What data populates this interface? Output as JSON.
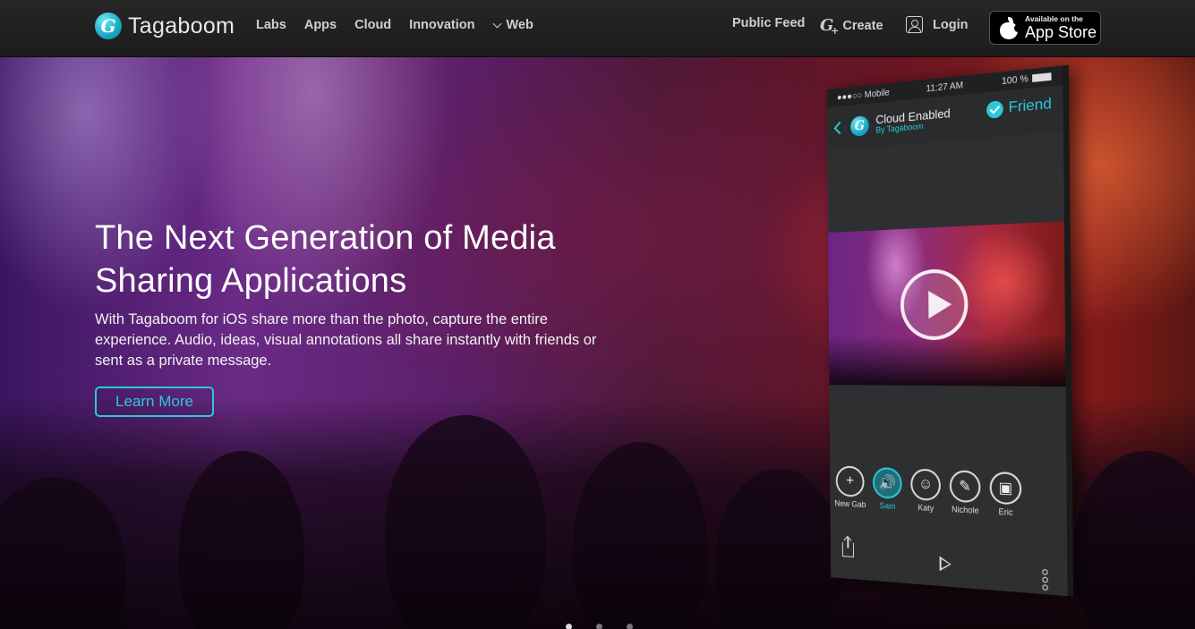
{
  "brand": {
    "name": "Tagaboom",
    "logo_letter": "G"
  },
  "nav": {
    "items": [
      {
        "label": "Labs"
      },
      {
        "label": "Apps"
      },
      {
        "label": "Cloud"
      },
      {
        "label": "Innovation"
      },
      {
        "label": "Web"
      }
    ],
    "public_feed": "Public Feed",
    "create": "Create",
    "login": "Login",
    "app_store": {
      "small": "Available on the",
      "big": "App Store"
    }
  },
  "hero": {
    "title": "The Next Generation of Media Sharing Applications",
    "text": "With Tagaboom for iOS share more than the photo, capture the entire experience. Audio, ideas, visual annotations all share instantly with friends or sent as a private message.",
    "cta": "Learn More"
  },
  "phone": {
    "carrier": "Mobile",
    "time": "11:27 AM",
    "battery": "100 %",
    "title": "Cloud Enabled",
    "subtitle": "By Tagaboom",
    "friend_label": "Friend",
    "people": [
      {
        "name": "New Gab",
        "icon": "plus-icon",
        "glyph": "+"
      },
      {
        "name": "Sam",
        "icon": "speaker-icon",
        "glyph": "🔊",
        "active": true
      },
      {
        "name": "Katy",
        "icon": "smiley-icon",
        "glyph": "☺"
      },
      {
        "name": "Nichole",
        "icon": "pencil-icon",
        "glyph": "✎"
      },
      {
        "name": "Eric",
        "icon": "picture-icon",
        "glyph": "▣"
      }
    ]
  },
  "carousel": {
    "count": 3,
    "active_index": 0
  },
  "colors": {
    "accent": "#2cc8d9",
    "nav_bg": "#222222"
  }
}
